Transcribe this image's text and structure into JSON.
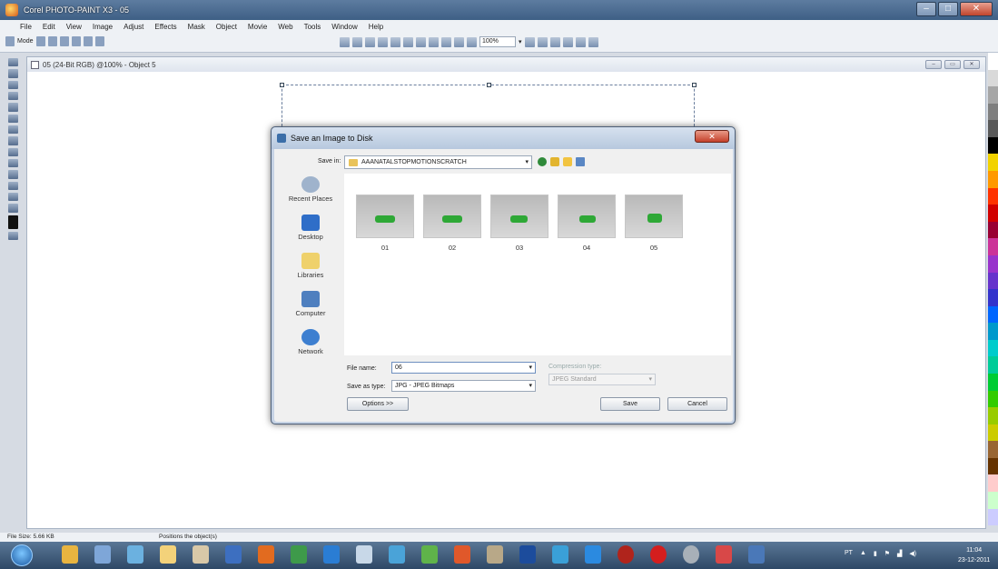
{
  "app": {
    "title": "Corel PHOTO-PAINT X3 - 05"
  },
  "menu": [
    "File",
    "Edit",
    "View",
    "Image",
    "Adjust",
    "Effects",
    "Mask",
    "Object",
    "Movie",
    "Web",
    "Tools",
    "Window",
    "Help"
  ],
  "toolbar": {
    "mode_label": "Mode",
    "zoom": "100%"
  },
  "document": {
    "title": "05 (24-Bit RGB) @100% - Object 5"
  },
  "dialog": {
    "title": "Save an Image to Disk",
    "save_in_label": "Save in:",
    "save_in_value": "AAANATALSTOPMOTIONSCRATCH",
    "places": [
      "Recent Places",
      "Desktop",
      "Libraries",
      "Computer",
      "Network"
    ],
    "files": [
      "01",
      "02",
      "03",
      "04",
      "05"
    ],
    "file_name_label": "File name:",
    "file_name_value": "06",
    "save_type_label": "Save as type:",
    "save_type_value": "JPG - JPEG Bitmaps",
    "compression_label": "Compression type:",
    "compression_value": "JPEG Standard",
    "options_button": "Options >>",
    "save_button": "Save",
    "cancel_button": "Cancel"
  },
  "status": {
    "file_size": "File Size: 5.66 KB",
    "hint": "Positions the object(s)"
  },
  "taskbar": {
    "lang": "PT",
    "time": "11:04",
    "date": "23-12-2011"
  },
  "colors": {
    "titlebar": "#3e5f85",
    "dialog_frame": "#c6d3e5",
    "taskbar": "#2e4866",
    "accent": "#2ea836"
  }
}
